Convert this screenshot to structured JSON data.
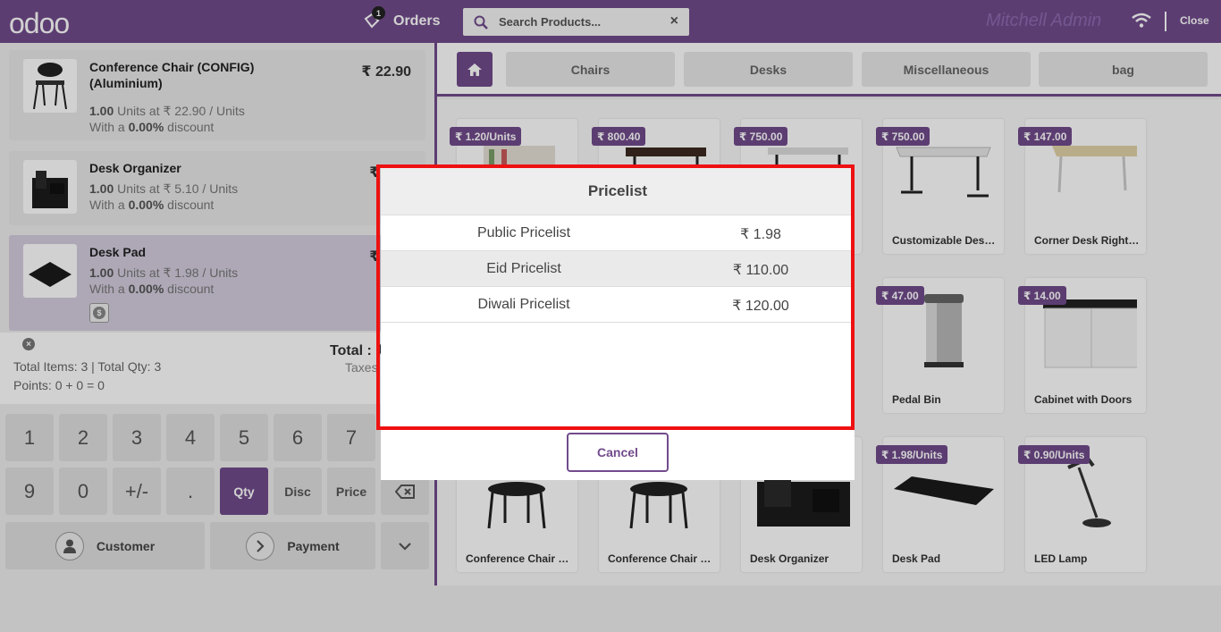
{
  "header": {
    "logo": "odoo",
    "orders_label": "Orders",
    "orders_count": "1",
    "search_placeholder": "Search Products...",
    "clear_icon": "×",
    "user": "Mitchell Admin",
    "close_label": "Close"
  },
  "order_lines": [
    {
      "name": "Conference Chair (CONFIG) (Aluminium)",
      "price": "₹ 22.90",
      "qty": "1.00",
      "unit_text": " Units at ₹ 22.90 / Units",
      "discount_prefix": "With a ",
      "discount": "0.00%",
      "discount_suffix": " discount"
    },
    {
      "name": "Desk Organizer",
      "price": "₹ 5.10",
      "qty": "1.00",
      "unit_text": " Units at ₹ 5.10 / Units",
      "discount_prefix": "With a ",
      "discount": "0.00%",
      "discount_suffix": " discount"
    },
    {
      "name": "Desk Pad",
      "price": "₹ 1.98",
      "qty": "1.00",
      "unit_text": " Units at ₹ 1.98 / Units",
      "discount_prefix": "With a ",
      "discount": "0.00%",
      "discount_suffix": " discount"
    }
  ],
  "summary": {
    "total_label": "Total : ₹",
    "taxes_label": "Taxes",
    "items_text": "Total Items: 3  |  Total Qty: 3",
    "points_text": "Points: 0 + 0 = 0"
  },
  "numpad": {
    "row1": [
      "1",
      "2",
      "3",
      "4",
      "5",
      "6",
      "7"
    ],
    "row2": [
      "9",
      "0",
      "+/-",
      ".",
      "Qty",
      "Disc",
      "Price"
    ],
    "customer": "Customer",
    "payment": "Payment"
  },
  "categories": [
    "Chairs",
    "Desks",
    "Miscellaneous",
    "bag"
  ],
  "products": [
    {
      "name": "",
      "price": "₹ 1.20/Units"
    },
    {
      "name": "",
      "price": "₹ 800.40"
    },
    {
      "name": "",
      "price": "₹ 750.00"
    },
    {
      "name": "Customizable Desk (CONFIG)",
      "price": "₹ 750.00"
    },
    {
      "name": "Corner Desk Right Sit",
      "price": "₹ 147.00"
    },
    {
      "name": "Pedal Bin",
      "price": "₹ 47.00"
    },
    {
      "name": "Cabinet with Doors",
      "price": "₹ 14.00"
    },
    {
      "name": "Conference Chair (CONFIG)",
      "price": ""
    },
    {
      "name": "Conference Chair (CONFIG)",
      "price": ""
    },
    {
      "name": "Desk Organizer",
      "price": ""
    },
    {
      "name": "Desk Pad",
      "price": "₹ 1.98/Units"
    },
    {
      "name": "LED Lamp",
      "price": "₹ 0.90/Units"
    }
  ],
  "modal": {
    "title": "Pricelist",
    "rows": [
      {
        "name": "Public Pricelist",
        "value": "₹ 1.98"
      },
      {
        "name": "Eid Pricelist",
        "value": "₹ 110.00"
      },
      {
        "name": "Diwali Pricelist",
        "value": "₹ 120.00"
      }
    ],
    "cancel": "Cancel"
  },
  "colors": {
    "brand": "#714B8C",
    "highlight": "#ee1111"
  }
}
